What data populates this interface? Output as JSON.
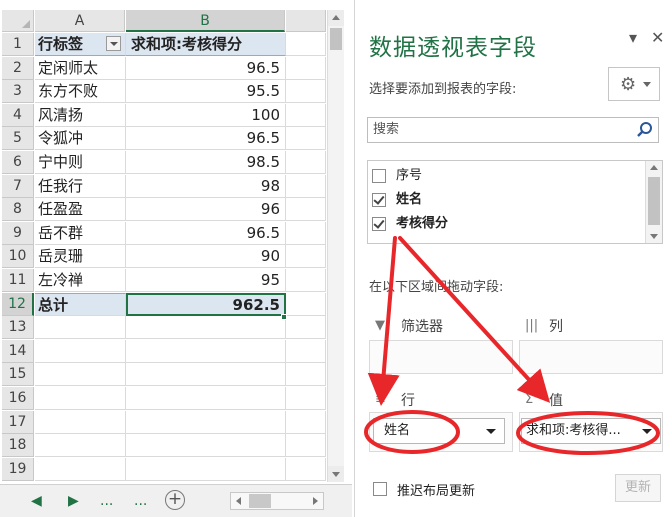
{
  "sheet": {
    "columns": [
      "A",
      "B"
    ],
    "row_numbers": [
      "1",
      "2",
      "3",
      "4",
      "5",
      "6",
      "7",
      "8",
      "9",
      "10",
      "11",
      "12",
      "13",
      "14",
      "15",
      "16",
      "17",
      "18",
      "19"
    ],
    "pivot_header": {
      "a": "行标签",
      "b": "求和项:考核得分"
    },
    "pivot_rows": [
      {
        "name": "定闲师太",
        "score": "96.5"
      },
      {
        "name": "东方不败",
        "score": "95.5"
      },
      {
        "name": "风清扬",
        "score": "100"
      },
      {
        "name": "令狐冲",
        "score": "96.5"
      },
      {
        "name": "宁中则",
        "score": "98.5"
      },
      {
        "name": "任我行",
        "score": "98"
      },
      {
        "name": "任盈盈",
        "score": "96"
      },
      {
        "name": "岳不群",
        "score": "96.5"
      },
      {
        "name": "岳灵珊",
        "score": "90"
      },
      {
        "name": "左冷禅",
        "score": "95"
      }
    ],
    "total": {
      "label": "总计",
      "value": "962.5"
    },
    "tab_bar": {
      "ellipsis_left": "...",
      "ellipsis_right": "...",
      "add": "+"
    }
  },
  "pane": {
    "title": "数据透视表字段",
    "choose_label": "选择要添加到报表的字段:",
    "search_placeholder": "搜索",
    "fields": [
      {
        "label": "序号",
        "checked": false
      },
      {
        "label": "姓名",
        "checked": true
      },
      {
        "label": "考核得分",
        "checked": true
      }
    ],
    "drag_label": "在以下区域间拖动字段:",
    "areas": {
      "filters": "筛选器",
      "columns": "列",
      "rows": "行",
      "values": "值"
    },
    "rows_chip": "姓名",
    "values_chip": "求和项:考核得...",
    "defer_label": "推迟布局更新",
    "update_button": "更新"
  },
  "colors": {
    "accent": "#217346",
    "pivot_header_fill": "#dce6f1",
    "annotation": "#e8272a"
  },
  "icons": [
    "gear-icon",
    "search-icon",
    "filter-icon",
    "columns-icon",
    "rows-icon",
    "sigma-icon",
    "close-icon",
    "chevron-down-icon"
  ]
}
